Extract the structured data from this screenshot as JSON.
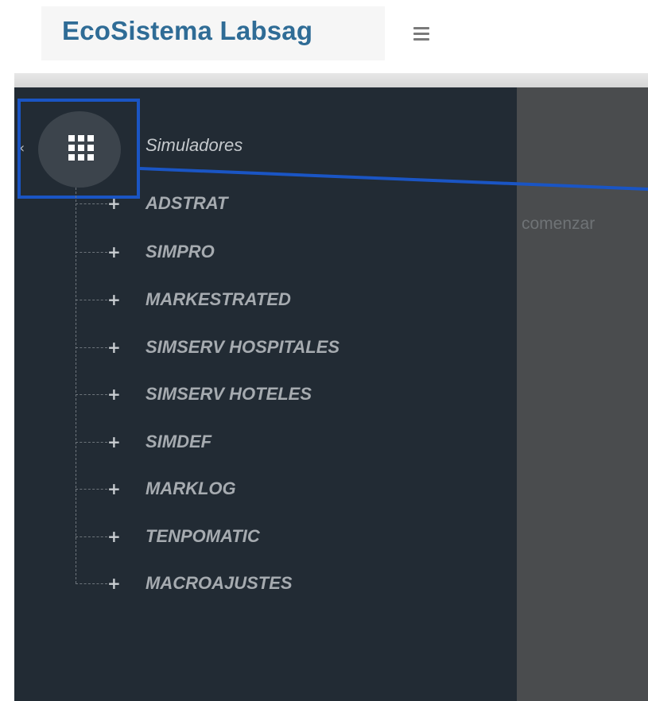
{
  "header": {
    "brand": "EcoSistema Labsag",
    "menu_icon": "hamburger-icon"
  },
  "sidebar": {
    "collapse_icon": "chevron-left-icon",
    "root": {
      "icon": "grid-apps-icon",
      "label": "Simuladores"
    },
    "items": [
      {
        "label": "ADSTRAT"
      },
      {
        "label": "SIMPRO"
      },
      {
        "label": "MARKESTRATED"
      },
      {
        "label": "SIMSERV HOSPITALES"
      },
      {
        "label": "SIMSERV HOTELES"
      },
      {
        "label": "SIMDEF"
      },
      {
        "label": "MARKLOG"
      },
      {
        "label": "TENPOMATIC"
      },
      {
        "label": "MACROAJUSTES"
      }
    ],
    "expand_icon": "plus-icon"
  },
  "content": {
    "text": "comenzar"
  },
  "colors": {
    "brand": "#2f6c96",
    "sidebar_bg": "#222b34",
    "content_bg": "#4a4c4e",
    "highlight": "#1a55c4"
  }
}
